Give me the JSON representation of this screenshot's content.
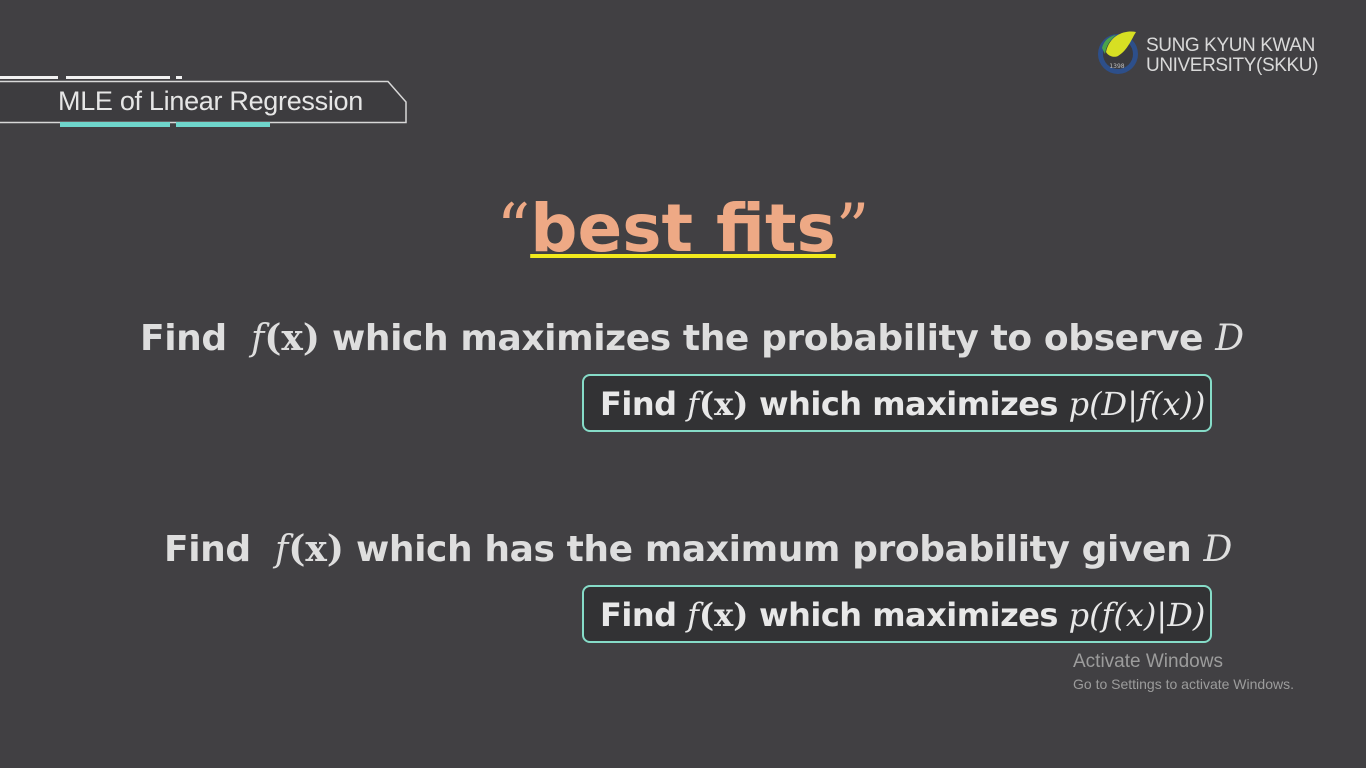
{
  "slide": {
    "section_title": "MLE of Linear Regression",
    "heading": {
      "open_quote": "“",
      "text": "best fits",
      "close_quote": "”"
    },
    "statement_1": {
      "prefix": "Find",
      "f": "f",
      "arg": "(x)",
      "suffix": "which maximizes the probability to observe",
      "var": "D"
    },
    "formal_1": {
      "prefix": "Find",
      "f": "f",
      "arg": "(x)",
      "middle": "which maximizes",
      "expr": "p(D|f(x))"
    },
    "statement_2": {
      "prefix": "Find",
      "f": "f",
      "arg": "(x)",
      "suffix": "which has the maximum probability given",
      "var": "D"
    },
    "formal_2": {
      "prefix": "Find",
      "f": "f",
      "arg": "(x)",
      "middle": "which maximizes",
      "expr": "p(f(x)|D)"
    }
  },
  "logo": {
    "line1": "SUNG KYUN KWAN",
    "line2": "UNIVERSITY(SKKU)",
    "emblem_year": "1398",
    "colors": {
      "ring": "#1e5aa8",
      "leaf": "#d7df23",
      "text": "#d9d9d9"
    }
  },
  "watermark": {
    "title": "Activate Windows",
    "subtitle": "Go to Settings to activate Windows."
  },
  "colors": {
    "background": "#414043",
    "heading": "#eea985",
    "underline": "#f2ea1c",
    "box_border": "#86dcc8",
    "tab_accent": "#6fd6cc"
  }
}
